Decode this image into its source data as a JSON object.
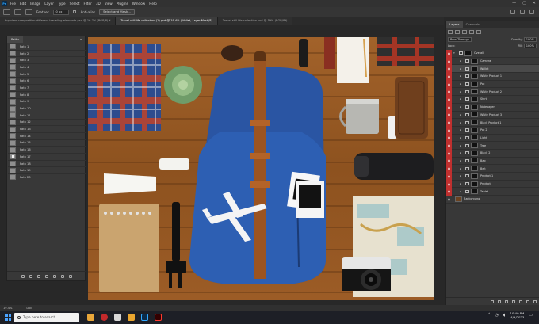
{
  "menubar": {
    "app_badge": "Ps",
    "items": [
      "File",
      "Edit",
      "Image",
      "Layer",
      "Type",
      "Select",
      "Filter",
      "3D",
      "View",
      "Plugins",
      "Window",
      "Help"
    ],
    "window_controls": [
      "—",
      "▢",
      "✕"
    ]
  },
  "options": {
    "feather_label": "Feather:",
    "feather_value": "0 px",
    "antialias_label": "Anti-alias",
    "select_mask_label": "Select and Mask..."
  },
  "tabs": [
    {
      "label": "top-view-composition-different-traveling-elements.psd @ 16.7% (RGB/8) *",
      "active": false
    },
    {
      "label": "Travel still life collection (1).psd @ 19.4% (Wallet, Layer Mask/8)",
      "active": true
    },
    {
      "label": "Travel still life collection.psd @ 19% (RGB/8*)",
      "active": false
    }
  ],
  "paths_panel": {
    "tab_label": "Paths",
    "paths": [
      "Path 1",
      "Path 2",
      "Path 3",
      "Path 4",
      "Path 5",
      "Path 6",
      "Path 7",
      "Path 8",
      "Path 9",
      "Path 10",
      "Path 11",
      "Path 12",
      "Path 13",
      "Path 14",
      "Path 15",
      "Path 16",
      "Path 17",
      "Path 18",
      "Path 19",
      "Path 20"
    ]
  },
  "layers_panel": {
    "tabs": [
      "Layers",
      "Channels"
    ],
    "blend_mode": "Pass Through",
    "opacity_label": "Opacity:",
    "opacity_value": "100%",
    "lock_label": "Lock:",
    "fill_label": "Fill:",
    "fill_value": "100%",
    "group_name": "Overall",
    "layers": [
      {
        "name": "Camera",
        "selected": false
      },
      {
        "name": "Wallet",
        "selected": true
      },
      {
        "name": "White Product 1",
        "selected": false
      },
      {
        "name": "Pot",
        "selected": false
      },
      {
        "name": "White Product 2",
        "selected": false
      },
      {
        "name": "Shirt",
        "selected": false
      },
      {
        "name": "Notepaper",
        "selected": false
      },
      {
        "name": "White Product 3",
        "selected": false
      },
      {
        "name": "Black Product 1",
        "selected": false
      },
      {
        "name": "Pot 2",
        "selected": false
      },
      {
        "name": "Light",
        "selected": false
      },
      {
        "name": "Tree",
        "selected": false
      },
      {
        "name": "Black 2",
        "selected": false
      },
      {
        "name": "Bag",
        "selected": false
      },
      {
        "name": "Belt",
        "selected": false
      },
      {
        "name": "Product 1",
        "selected": false
      },
      {
        "name": "Product",
        "selected": false
      },
      {
        "name": "Tablet",
        "selected": false
      }
    ],
    "background_name": "Background"
  },
  "status": {
    "zoom": "19.4%",
    "doc_size": "Doc"
  },
  "taskbar": {
    "search_placeholder": "Type here to search",
    "time": "10:40 PM",
    "date": "4/9/2023"
  }
}
